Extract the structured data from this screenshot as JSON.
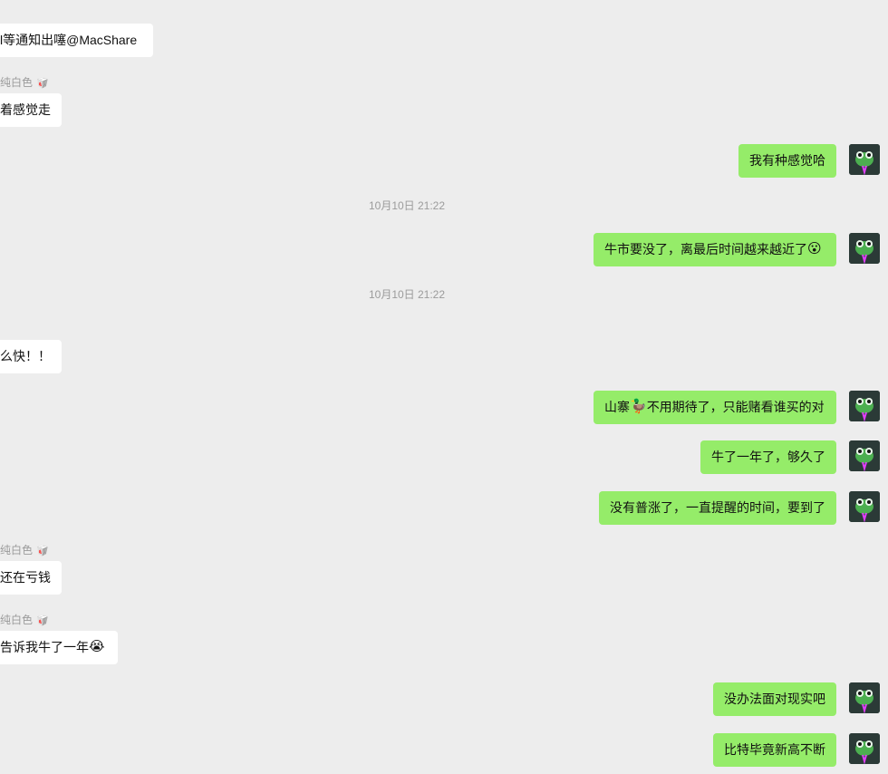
{
  "messages": [
    {
      "text": "l等通知出噻@MacShare"
    },
    {
      "sender": "纯白色",
      "sender_emoji": "🥡",
      "text": "着感觉走"
    },
    {
      "text": "我有种感觉哈"
    },
    {
      "time": "10月10日 21:22"
    },
    {
      "text": "牛市要没了，离最后时间越来越近了",
      "emoji": "😮"
    },
    {
      "time": "10月10日 21:22"
    },
    {
      "text": "么快！！"
    },
    {
      "text_before": "山寨",
      "emoji": "🦆",
      "text_after": "不用期待了，只能赌看谁买的对"
    },
    {
      "text": "牛了一年了，够久了"
    },
    {
      "text": "没有普涨了，一直提醒的时间，要到了"
    },
    {
      "sender": "纯白色",
      "sender_emoji": "🥡",
      "text": "还在亏钱"
    },
    {
      "sender": "纯白色",
      "sender_emoji": "🥡",
      "text": "告诉我牛了一年",
      "emoji": "😭"
    },
    {
      "text": "没办法面对现实吧"
    },
    {
      "text": "比特毕竟新高不断"
    }
  ],
  "colors": {
    "outgoing": "#95ec69",
    "incoming": "#ffffff",
    "background": "#ededed"
  },
  "icons": {
    "avatar": "green-frog-avatar-icon"
  }
}
